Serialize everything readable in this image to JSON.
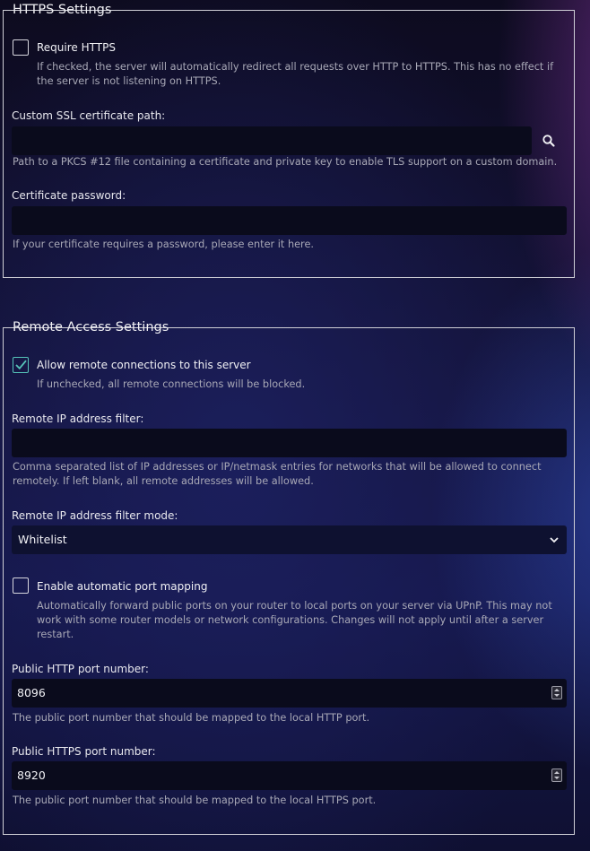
{
  "https": {
    "legend": "HTTPS Settings",
    "require_https": {
      "label": "Require HTTPS",
      "checked": false,
      "description": "If checked, the server will automatically redirect all requests over HTTP to HTTPS. This has no effect if the server is not listening on HTTPS."
    },
    "cert_path": {
      "label": "Custom SSL certificate path:",
      "value": "",
      "description": "Path to a PKCS #12 file containing a certificate and private key to enable TLS support on a custom domain.",
      "button_icon": "search-icon"
    },
    "cert_password": {
      "label": "Certificate password:",
      "value": "",
      "description": "If your certificate requires a password, please enter it here."
    }
  },
  "remote": {
    "legend": "Remote Access Settings",
    "allow_remote": {
      "label": "Allow remote connections to this server",
      "checked": true,
      "description": "If unchecked, all remote connections will be blocked."
    },
    "ip_filter": {
      "label": "Remote IP address filter:",
      "value": "",
      "description": "Comma separated list of IP addresses or IP/netmask entries for networks that will be allowed to connect remotely. If left blank, all remote addresses will be allowed."
    },
    "filter_mode": {
      "label": "Remote IP address filter mode:",
      "value": "Whitelist"
    },
    "port_mapping": {
      "label": "Enable automatic port mapping",
      "checked": false,
      "description": "Automatically forward public ports on your router to local ports on your server via UPnP. This may not work with some router models or network configurations. Changes will not apply until after a server restart."
    },
    "http_port": {
      "label": "Public HTTP port number:",
      "value": "8096",
      "description": "The public port number that should be mapped to the local HTTP port."
    },
    "https_port": {
      "label": "Public HTTPS port number:",
      "value": "8920",
      "description": "The public port number that should be mapped to the local HTTPS port."
    }
  },
  "colors": {
    "accent": "#56c4b9",
    "input_bg": "#0a0b1c"
  }
}
